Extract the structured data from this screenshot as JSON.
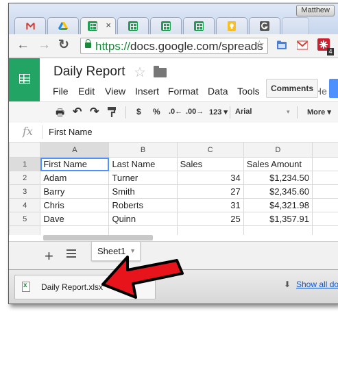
{
  "browser": {
    "user_name": "Matthew",
    "active_tab_close": "×",
    "url_protocol": "https://",
    "url_rest": "docs.google.com/spreads",
    "nav": {
      "back": "←",
      "forward": "→",
      "reload": "↻"
    },
    "bookmark_star": "☆",
    "tab_icons": [
      "gmail-icon",
      "drive-icon",
      "sheets-icon",
      "sheets-icon",
      "sheets-icon",
      "sheets-icon",
      "keep-icon",
      "grammarly-icon"
    ],
    "extension_icons": [
      "bookmark-folder-icon",
      "gmail-icon",
      "lastpass-icon"
    ],
    "extension_badge": "4"
  },
  "docs": {
    "title": "Daily Report",
    "title_star": "☆",
    "menu": [
      "File",
      "Edit",
      "View",
      "Insert",
      "Format",
      "Data",
      "Tools"
    ],
    "menu_overflow": "He",
    "comments_label": "Comments"
  },
  "format_toolbar": {
    "print": "🖶",
    "undo": "↶",
    "redo": "↷",
    "currency": "$",
    "percent": "%",
    "decrease_decimals": ".0←",
    "increase_decimals": ".00→",
    "more_formats": "123 ▾",
    "font": "Arial",
    "font_caret": "▾",
    "more_label": "More ▾"
  },
  "formula_bar": {
    "fx_label": "fx",
    "value": "First Name"
  },
  "sheet": {
    "columns": [
      "A",
      "B",
      "C",
      "D"
    ],
    "rows": [
      {
        "n": "1",
        "cells": [
          "First Name",
          "Last Name",
          "Sales",
          "Sales Amount"
        ]
      },
      {
        "n": "2",
        "cells": [
          "Adam",
          "Turner",
          "34",
          "$1,234.50"
        ]
      },
      {
        "n": "3",
        "cells": [
          "Barry",
          "Smith",
          "27",
          "$2,345.60"
        ]
      },
      {
        "n": "4",
        "cells": [
          "Chris",
          "Roberts",
          "31",
          "$4,321.98"
        ]
      },
      {
        "n": "5",
        "cells": [
          "Dave",
          "Quinn",
          "25",
          "$1,357.91"
        ]
      }
    ],
    "tab_name": "Sheet1",
    "add_sheet": "+"
  },
  "downloads": {
    "file_name": "Daily Report.xlsx",
    "show_all": "Show all do",
    "show_all_icon": "⬇"
  },
  "colors": {
    "sheets_green": "#21a464",
    "annotation_red": "#e8141c",
    "link_blue": "#1155cc",
    "selection_blue": "#4d90fe"
  }
}
